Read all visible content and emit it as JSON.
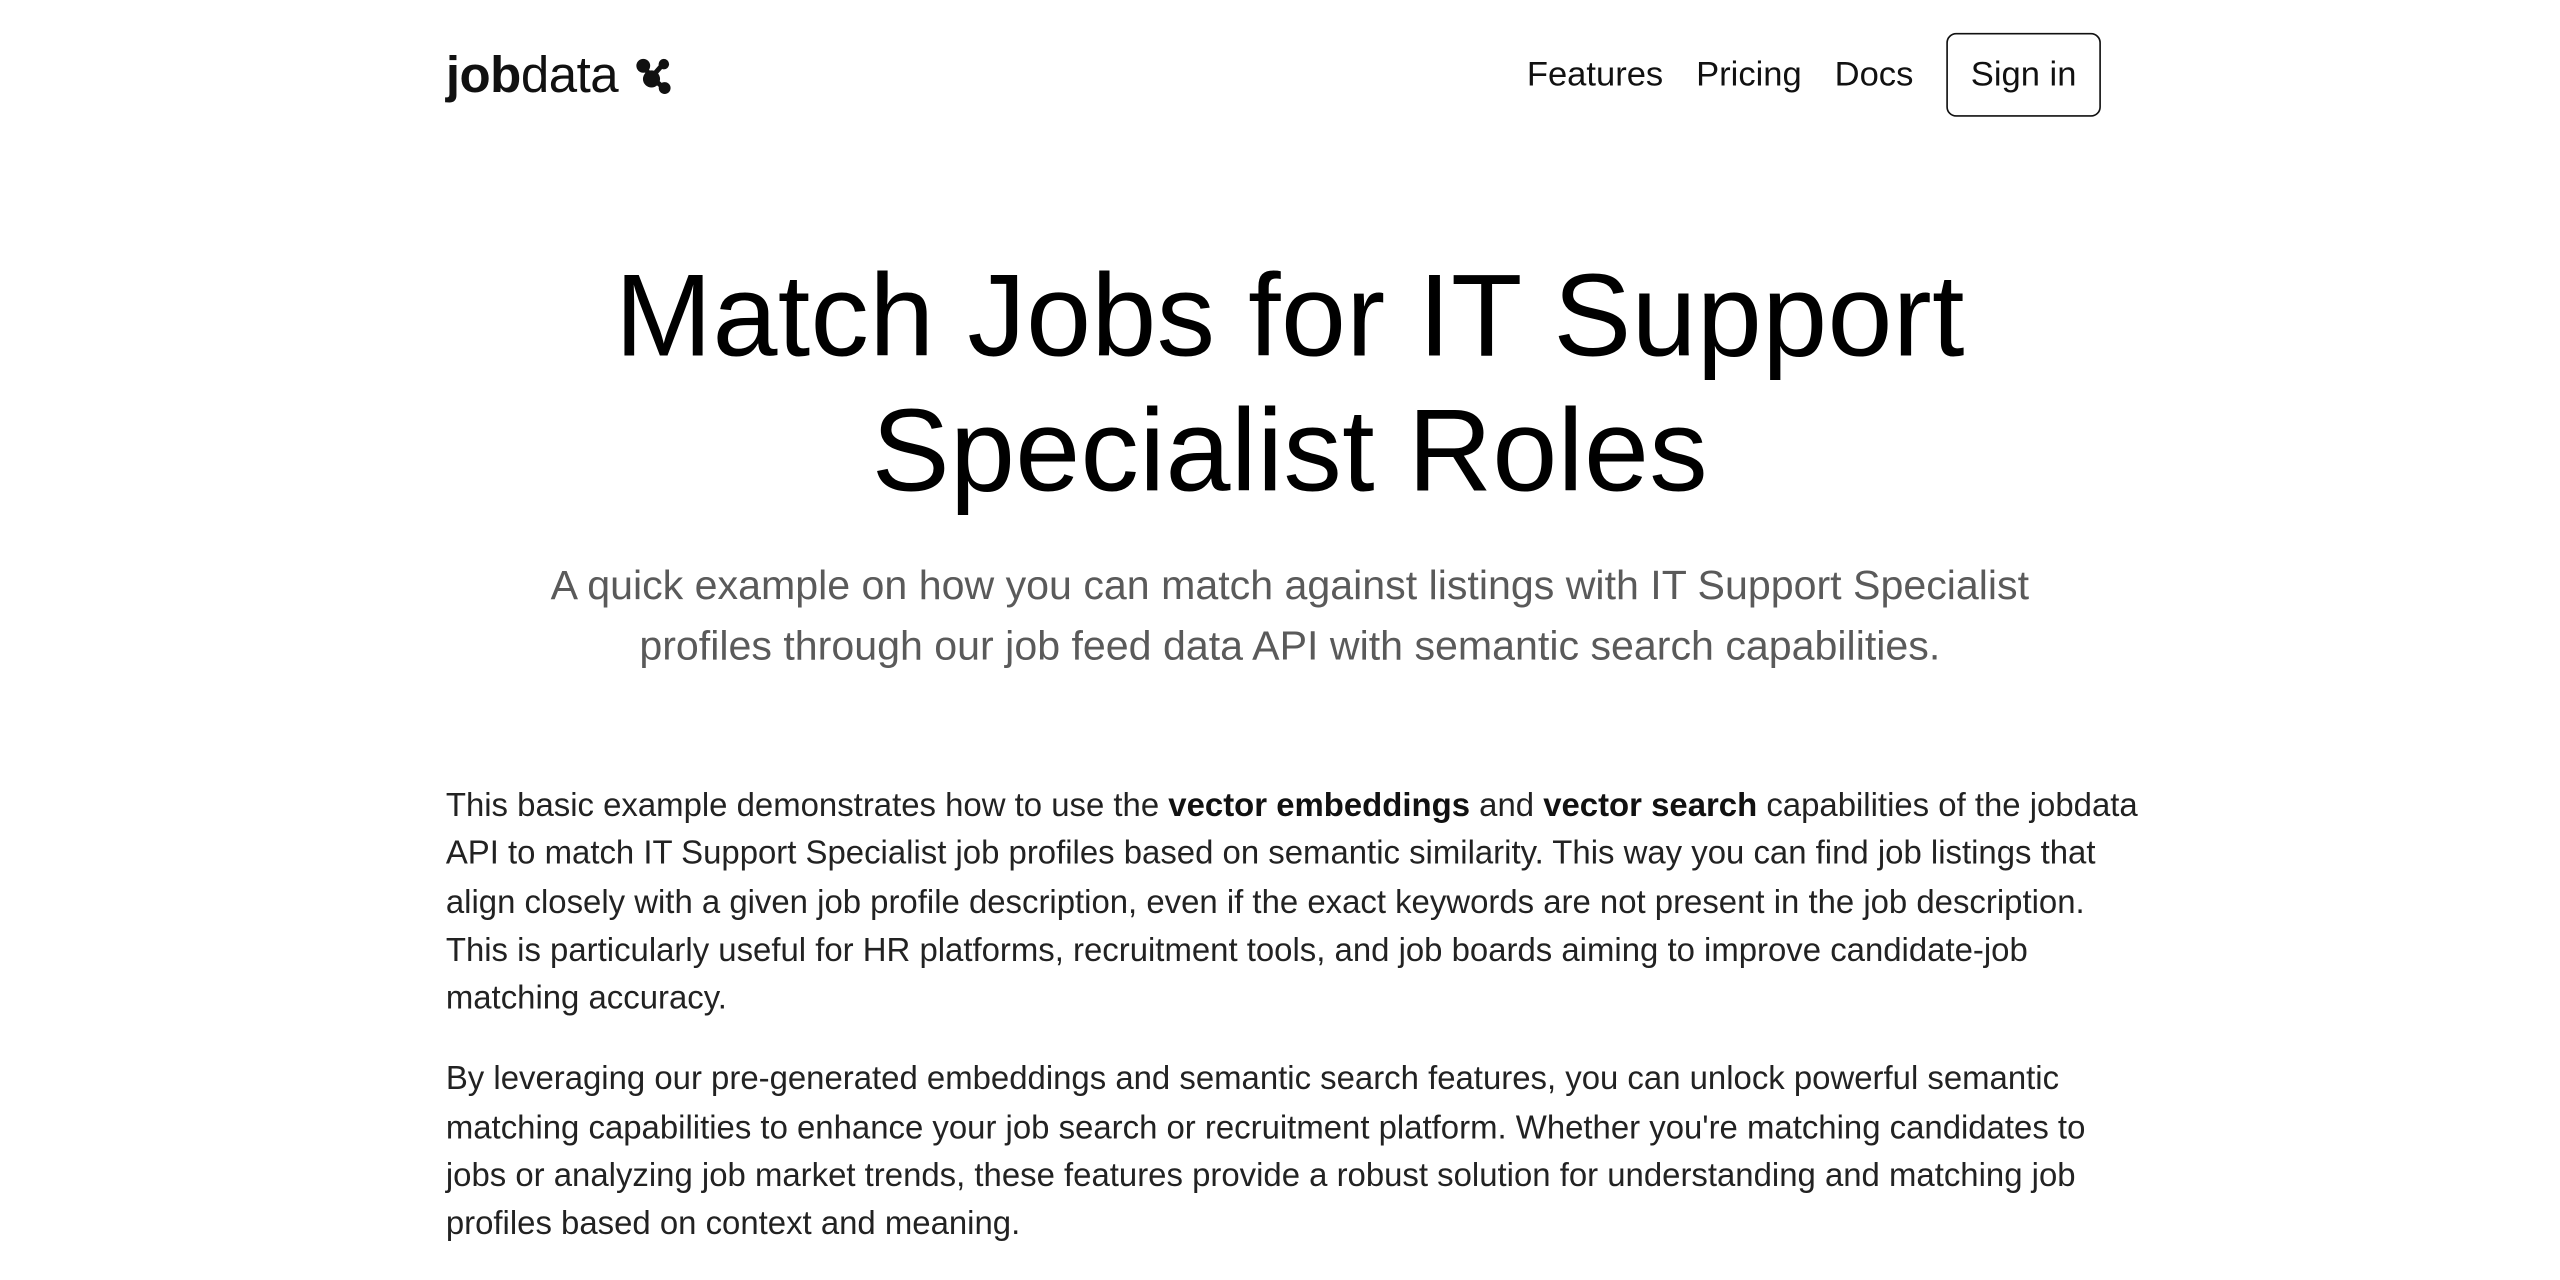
{
  "header": {
    "brand": {
      "strong": "job",
      "light": "data",
      "icon": "molecule-icon"
    },
    "nav": [
      {
        "label": "Features"
      },
      {
        "label": "Pricing"
      },
      {
        "label": "Docs"
      }
    ],
    "signin_label": "Sign in"
  },
  "hero": {
    "title_line1": "Match Jobs for IT Support",
    "title_line2": "Specialist Roles",
    "subtitle": "A quick example on how you can match against listings with IT Support Specialist profiles through our job feed data API with semantic search capabilities."
  },
  "body": {
    "p1": {
      "t1": "This basic example demonstrates how to use the ",
      "b1": "vector embeddings",
      "t2": " and ",
      "b2": "vector search",
      "t3": " capabilities of the jobdata API to match IT Support Specialist job profiles based on semantic similarity. This way you can find job listings that align closely with a given job profile description, even if the exact keywords are not present in the job description. This is particularly useful for HR platforms, recruitment tools, and job boards aiming to improve candidate-job matching accuracy."
    },
    "p2": "By leveraging our pre-generated embeddings and semantic search features, you can unlock powerful semantic matching capabilities to enhance your job search or recruitment platform. Whether you're matching candidates to jobs or analyzing job market trends, these features provide a robust solution for understanding and matching job profiles based on context and meaning."
  },
  "colors": {
    "text": "#111111",
    "muted": "#5a5a5a",
    "body": "#222222",
    "background": "#ffffff"
  }
}
